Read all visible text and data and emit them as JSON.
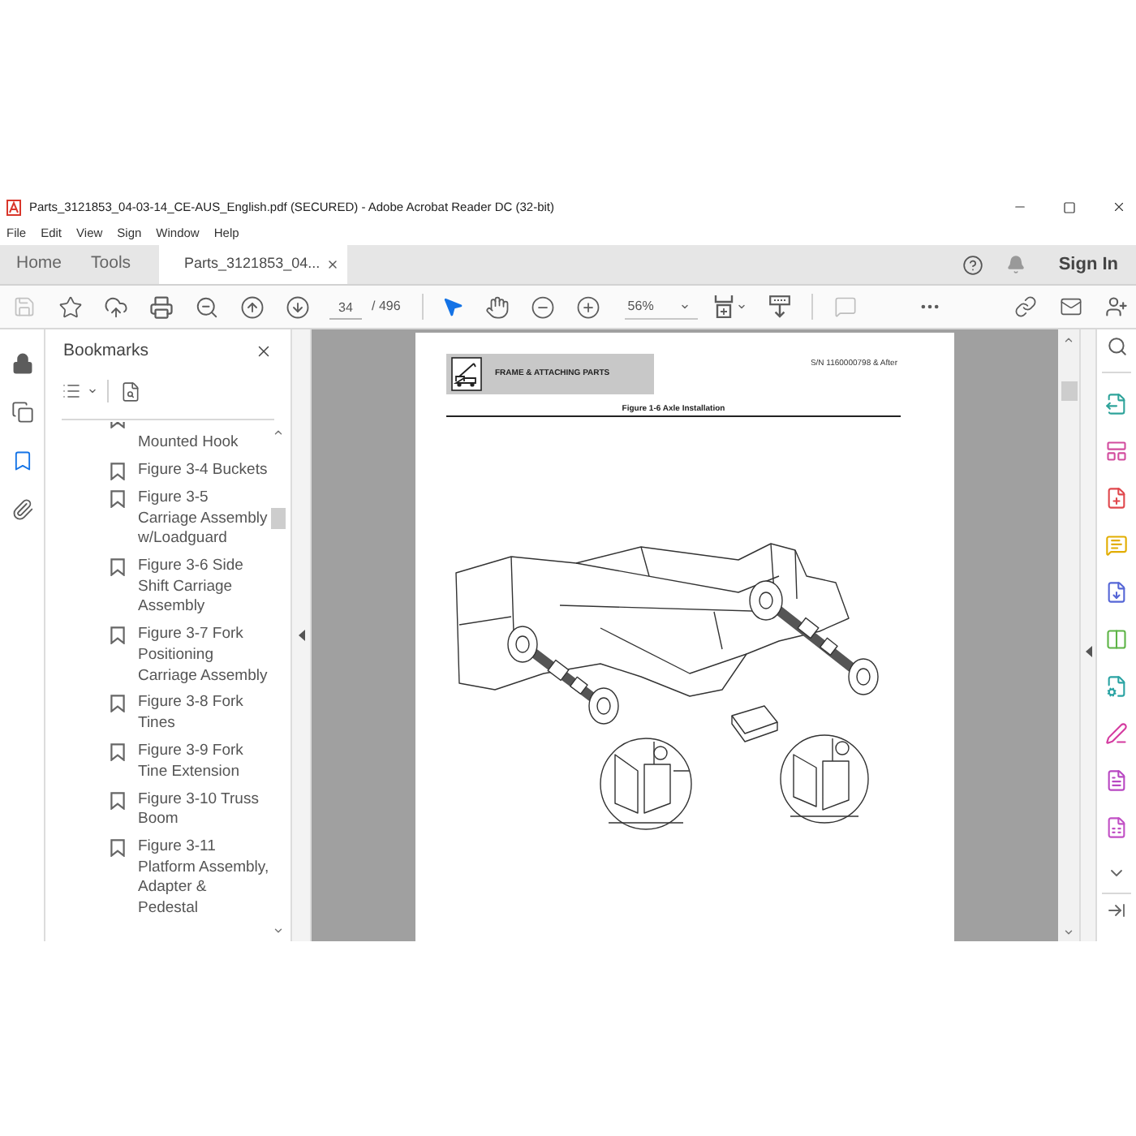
{
  "window": {
    "title": "Parts_3121853_04-03-14_CE-AUS_English.pdf (SECURED) - Adobe Acrobat Reader DC (32-bit)"
  },
  "menu": [
    "File",
    "Edit",
    "View",
    "Sign",
    "Window",
    "Help"
  ],
  "tabs": [
    {
      "label": "Home",
      "kind": "nav",
      "selected": false
    },
    {
      "label": "Tools",
      "kind": "nav",
      "selected": false
    },
    {
      "label": "Parts_3121853_04...",
      "kind": "document",
      "selected": true
    }
  ],
  "account": {
    "sign_in": "Sign In"
  },
  "toolbar": {
    "save_disabled": true,
    "page_number": "34",
    "page_count": "/ 496",
    "pointer_selected": true,
    "hand_selected": false,
    "zoom": "56%",
    "comment_disabled": true
  },
  "nav_rail": [
    {
      "selected": false
    },
    {
      "selected": false
    },
    {
      "selected": true
    },
    {
      "selected": false
    }
  ],
  "bookmarks": {
    "title": "Bookmarks",
    "items": [
      {
        "label": "Mounted Hook",
        "partial": true
      },
      {
        "label": "Figure 3-4 Buckets",
        "partial": false
      },
      {
        "label": "Figure 3-5 Carriage Assembly w/Loadguard",
        "partial": false
      },
      {
        "label": "Figure 3-6 Side Shift Carriage Assembly",
        "partial": false
      },
      {
        "label": "Figure 3-7 Fork Positioning Carriage Assembly",
        "partial": false
      },
      {
        "label": "Figure 3-8 Fork Tines",
        "partial": false
      },
      {
        "label": "Figure 3-9 Fork Tine Extension",
        "partial": false
      },
      {
        "label": "Figure 3-10 Truss Boom",
        "partial": false
      },
      {
        "label": "Figure 3-11 Platform Assembly, Adapter & Pedestal",
        "partial": false
      }
    ]
  },
  "document": {
    "section": "FRAME & ATTACHING PARTS",
    "serial": "S/N 1160000798 & After",
    "figure_title": "Figure 1-6 Axle Installation"
  }
}
